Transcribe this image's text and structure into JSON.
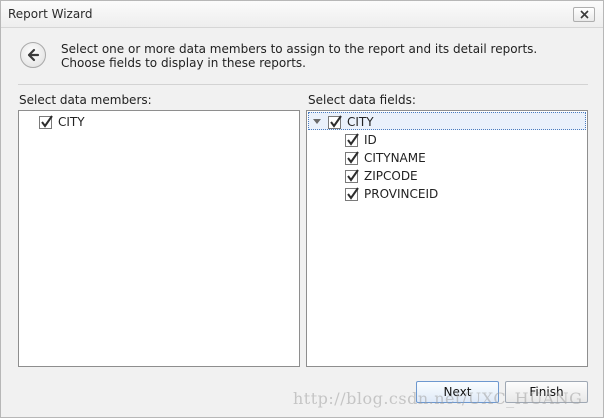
{
  "window": {
    "title": "Report Wizard",
    "description_line1": "Select one or more data members to assign to the report and its detail reports.",
    "description_line2": "Choose fields to display in these reports."
  },
  "members": {
    "label": "Select data members:",
    "items": [
      {
        "label": "CITY",
        "checked": true
      }
    ]
  },
  "fields": {
    "label": "Select data fields:",
    "root": {
      "label": "CITY",
      "checked": true,
      "expanded": true
    },
    "children": [
      {
        "label": "ID",
        "checked": true
      },
      {
        "label": "CITYNAME",
        "checked": true
      },
      {
        "label": "ZIPCODE",
        "checked": true
      },
      {
        "label": "PROVINCEID",
        "checked": true
      }
    ]
  },
  "buttons": {
    "next": "Next",
    "finish": "Finish"
  },
  "watermark": "http://blog.csdn.net/UXC_HUANG",
  "icons": {
    "close": "close-icon",
    "back": "back-arrow-icon",
    "check": "checkmark-icon",
    "expander": "expander-triangle-icon"
  }
}
